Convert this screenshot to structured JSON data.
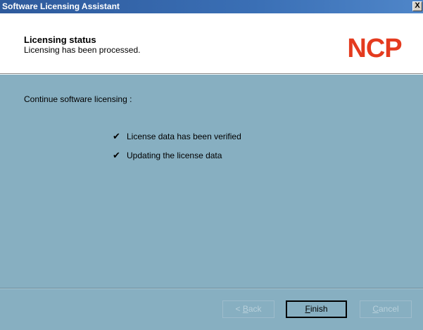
{
  "window": {
    "title": "Software Licensing Assistant",
    "close_label": "X"
  },
  "header": {
    "title": "Licensing status",
    "subtitle": "Licensing has been processed.",
    "logo_text": "NCP",
    "logo_color": "#e43b1f"
  },
  "content": {
    "label": "Continue software licensing :",
    "items": [
      {
        "check": "✔",
        "label": "License data has been verified"
      },
      {
        "check": "✔",
        "label": "Updating the license data"
      }
    ]
  },
  "buttons": {
    "back": {
      "prefix": "< ",
      "mnemonic": "B",
      "rest": "ack"
    },
    "finish": {
      "mnemonic": "F",
      "rest": "inish"
    },
    "cancel": {
      "mnemonic": "C",
      "rest": "ancel"
    }
  },
  "colors": {
    "background": "#87afc1",
    "titlebar": "#2e5a9c",
    "header_bg": "#ffffff",
    "disabled_text": "#b8d0db"
  }
}
